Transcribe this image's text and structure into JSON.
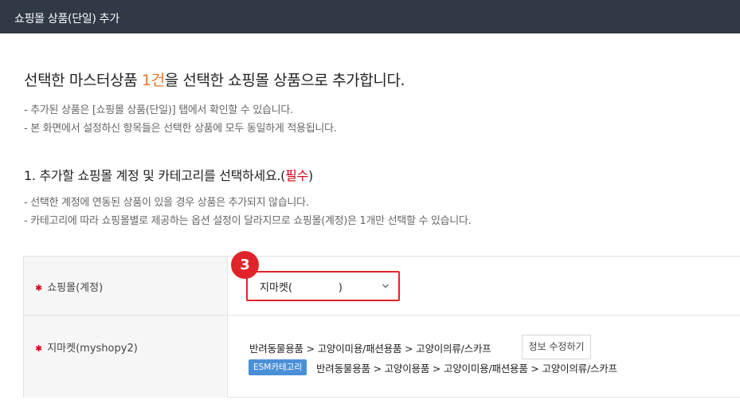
{
  "window": {
    "title": "쇼핑몰 상품(단일) 추가"
  },
  "headline": {
    "before": "선택한 마스터상품 ",
    "count": "1건",
    "after": "을 선택한 쇼핑몰 상품으로 추가합니다."
  },
  "notes": [
    "- 추가된 상품은 [쇼핑몰 상품(단일)] 탭에서 확인할 수 있습니다.",
    "- 본 화면에서 설정하신 항목들은 선택한 상품에 모두 동일하게 적용됩니다."
  ],
  "section1": {
    "title": "1. 추가할 쇼핑몰 계정 및 카테고리를 선택하세요.",
    "required_open": "(",
    "required_label": "필수",
    "required_close": ")",
    "notes": [
      "- 선택한 계정에 연동된 상품이 있을 경우 상품은 추가되지 않습니다.",
      "- 카테고리에 따라 쇼핑몰별로 제공하는 옵션 설정이 달라지므로 쇼핑몰(계정)은 1개만 선택할 수 있습니다."
    ]
  },
  "form": {
    "required_mark": "✱",
    "step_badge": "3",
    "shop_account": {
      "label": "쇼핑몰(계정)",
      "selected": "지마켓(              )"
    },
    "market_row": {
      "label": "지마켓(myshopy2)",
      "category_path": "반려동물용품 > 고양이미용/패션용품 > 고양이의류/스카프",
      "esm_badge": "ESM카테고리",
      "esm_category_path": "반려동물용품 > 고양이용품 > 고양이미용/패션용품 > 고양이의류/스카프",
      "edit_button": "정보 수정하기"
    }
  },
  "colors": {
    "titlebar": "#2f3a46",
    "accent": "#e8762c",
    "required": "#d0021b",
    "highlight": "#e0242a",
    "esm_badge": "#4a90d9"
  },
  "icons": {
    "select_arrow": "chevron-down-icon"
  }
}
